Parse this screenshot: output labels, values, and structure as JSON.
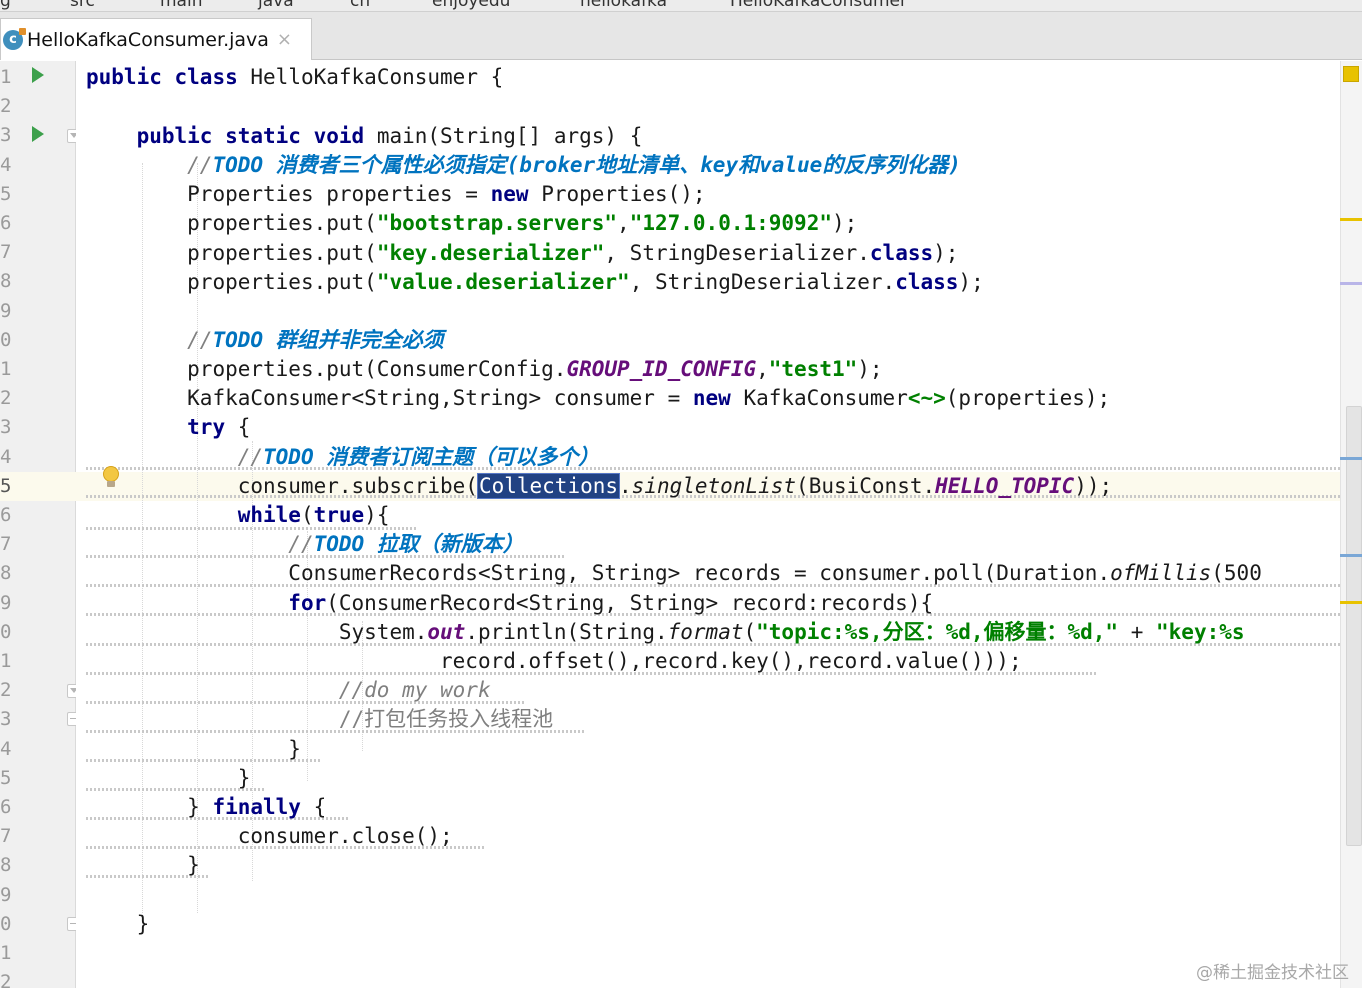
{
  "tab": {
    "file_name": "HelloKafkaConsumer.java",
    "close_glyph": "×",
    "icon_letter": "c"
  },
  "breadcrumb": {
    "items": [
      "g",
      "src",
      "main",
      "java",
      "cn",
      "enjoyedu",
      "hellokafka",
      "HelloKafkaConsumer"
    ]
  },
  "editor": {
    "line_numbers": [
      "1",
      "2",
      "3",
      "4",
      "5",
      "6",
      "7",
      "8",
      "9",
      "0",
      "1",
      "2",
      "3",
      "4",
      "5",
      "6",
      "7",
      "8",
      "9",
      "0",
      "1",
      "2",
      "3",
      "4",
      "5",
      "6",
      "7",
      "8",
      "9",
      "0",
      "1",
      "2"
    ],
    "selected_word": "Collections"
  },
  "code": {
    "l1": {
      "kw1": "public",
      "kw2": "class",
      "name": "HelloKafkaConsumer {"
    },
    "l3": {
      "kw1": "public",
      "kw2": "static",
      "kw3": "void",
      "rest": "main(String[] args) {"
    },
    "l4": {
      "slashes": "//",
      "todo": "TODO 消费者三个属性必须指定(broker地址清单、key和value的反序列化器)"
    },
    "l5": {
      "a": "Properties properties = ",
      "kw": "new",
      "b": "Properties();"
    },
    "l6": {
      "a": "properties.put(",
      "s1": "\"bootstrap.servers\"",
      "c": ",",
      "s2": "\"127.0.0.1:9092\"",
      "d": ");"
    },
    "l7": {
      "a": "properties.put(",
      "s1": "\"key.deserializer\"",
      "c": ", StringDeserializer.",
      "kw": "class",
      "d": ");"
    },
    "l8": {
      "a": "properties.put(",
      "s1": "\"value.deserializer\"",
      "c": ", StringDeserializer.",
      "kw": "class",
      "d": ");"
    },
    "l10": {
      "slashes": "//",
      "todo": "TODO 群组并非完全必须"
    },
    "l11": {
      "a": "properties.put(ConsumerConfig.",
      "const": "GROUP_ID_CONFIG",
      "c": ",",
      "s1": "\"test1\"",
      "d": ");"
    },
    "l12": {
      "a": "KafkaConsumer<String,String> consumer = ",
      "kw": "new",
      "b": " KafkaConsumer",
      "diamond": "<~>",
      "c": "(properties);"
    },
    "l13": {
      "kw": "try",
      "b": " {"
    },
    "l14": {
      "slashes": "//",
      "todo": "TODO 消费者订阅主题（可以多个）"
    },
    "l15": {
      "a": "consumer.subscribe(",
      "sel": "Collections",
      "b": ".",
      "ital": "singletonList",
      "c": "(BusiConst.",
      "const": "HELLO_TOPIC",
      "d": "));"
    },
    "l16": {
      "kw1": "while",
      "b": "(",
      "kw2": "true",
      "c": "){"
    },
    "l17": {
      "slashes": "//",
      "todo": "TODO 拉取（新版本）"
    },
    "l18": {
      "a": "ConsumerRecords<String, String> records = consumer.poll(Duration.",
      "ital": "ofMillis",
      "b": "(500"
    },
    "l19": {
      "kw": "for",
      "a": "(ConsumerRecord<String, String> record:records){"
    },
    "l20": {
      "a": "System.",
      "field": "out",
      "b": ".println(String.",
      "ital": "format",
      "c": "(",
      "s1": "\"topic:%s,分区：%d,偏移量：%d,\"",
      "d": " + ",
      "s2": "\"key:%s"
    },
    "l21": {
      "a": "record.offset(),record.key(),record.value()));"
    },
    "l22": {
      "cmt": "//do my work"
    },
    "l23": {
      "cmt": "//打包任务投入线程池"
    },
    "l24": {
      "a": "}"
    },
    "l25": {
      "a": "}"
    },
    "l26": {
      "a": "} ",
      "kw": "finally",
      "b": " {"
    },
    "l27": {
      "a": "consumer.close();"
    },
    "l28": {
      "a": "}"
    },
    "l30": {
      "a": "}"
    }
  },
  "watermark": "@稀土掘金技术社区",
  "colors": {
    "keyword": "#000080",
    "string": "#008000",
    "todo": "#0073bf",
    "comment": "#808080",
    "constant": "#660e7a",
    "selection": "#214283",
    "current_line": "#fcfaed"
  }
}
